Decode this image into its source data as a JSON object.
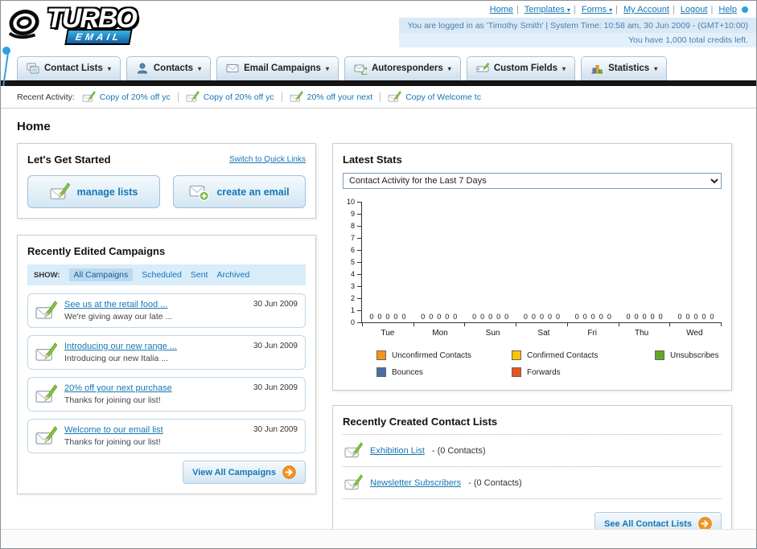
{
  "header": {
    "logo_line1": "TURBO",
    "logo_line2": "EMAIL",
    "top_links": [
      "Home",
      "Templates",
      "Forms",
      "My Account",
      "Logout",
      "Help"
    ],
    "session_line": "You are logged in as 'Timothy Smith' | System Time: 10:58 am, 30 Jun 2009 - (GMT+10:00)",
    "credits_line": "You have 1,000 total credits left."
  },
  "nav": {
    "items": [
      {
        "label": "Contact Lists",
        "icon": "contact-lists-icon"
      },
      {
        "label": "Contacts",
        "icon": "contacts-icon"
      },
      {
        "label": "Email Campaigns",
        "icon": "email-campaigns-icon"
      },
      {
        "label": "Autoresponders",
        "icon": "autoresponders-icon"
      },
      {
        "label": "Custom Fields",
        "icon": "custom-fields-icon"
      },
      {
        "label": "Statistics",
        "icon": "statistics-icon"
      }
    ]
  },
  "recent_activity": {
    "label": "Recent Activity:",
    "items": [
      "Copy of 20% off yc",
      "Copy of 20% off yc",
      "20% off your next",
      "Copy of Welcome tc"
    ]
  },
  "page": {
    "title": "Home"
  },
  "get_started": {
    "title": "Let's Get Started",
    "switch_link": "Switch to Quick Links",
    "manage_lists_button": "manage lists",
    "create_email_button": "create an email"
  },
  "campaigns": {
    "title": "Recently Edited Campaigns",
    "show_label": "SHOW:",
    "tabs": [
      "All Campaigns",
      "Scheduled",
      "Sent",
      "Archived"
    ],
    "items": [
      {
        "title": "See us at the retail food ...",
        "subtitle": "We're giving away our late ...",
        "date": "30 Jun 2009"
      },
      {
        "title": "Introducing our new range ...",
        "subtitle": "Introducing our new Italia ...",
        "date": "30 Jun 2009"
      },
      {
        "title": "20% off your next purchase",
        "subtitle": "Thanks for joining our list!",
        "date": "30 Jun 2009"
      },
      {
        "title": "Welcome to our email list",
        "subtitle": "Thanks for joining our list!",
        "date": "30 Jun 2009"
      }
    ],
    "view_all_button": "View All Campaigns"
  },
  "stats": {
    "title": "Latest Stats",
    "period_option": "Contact Activity for the Last 7 Days",
    "chart_data": {
      "type": "bar",
      "title": "Contact Activity for the Last 7 Days",
      "categories": [
        "Tue",
        "Mon",
        "Sun",
        "Sat",
        "Fri",
        "Thu",
        "Wed"
      ],
      "series": [
        {
          "name": "Unconfirmed Contacts",
          "color": "#f7941d",
          "values": [
            0,
            0,
            0,
            0,
            0,
            0,
            0
          ]
        },
        {
          "name": "Confirmed Contacts",
          "color": "#fdc500",
          "values": [
            0,
            0,
            0,
            0,
            0,
            0,
            0
          ]
        },
        {
          "name": "Unsubscribes",
          "color": "#64a825",
          "values": [
            0,
            0,
            0,
            0,
            0,
            0,
            0
          ]
        },
        {
          "name": "Bounces",
          "color": "#4a6fa5",
          "values": [
            0,
            0,
            0,
            0,
            0,
            0,
            0
          ]
        },
        {
          "name": "Forwards",
          "color": "#e8541d",
          "values": [
            0,
            0,
            0,
            0,
            0,
            0,
            0
          ]
        }
      ],
      "ylim": [
        0,
        10
      ],
      "y_tick_step": 1,
      "grid": false,
      "legend_position": "bottom"
    }
  },
  "contact_lists": {
    "title": "Recently Created Contact Lists",
    "items": [
      {
        "name": "Exhibition List",
        "detail": "- (0 Contacts)"
      },
      {
        "name": "Newsletter Subscribers",
        "detail": "- (0 Contacts)"
      }
    ],
    "see_all_button": "See All Contact Lists"
  }
}
